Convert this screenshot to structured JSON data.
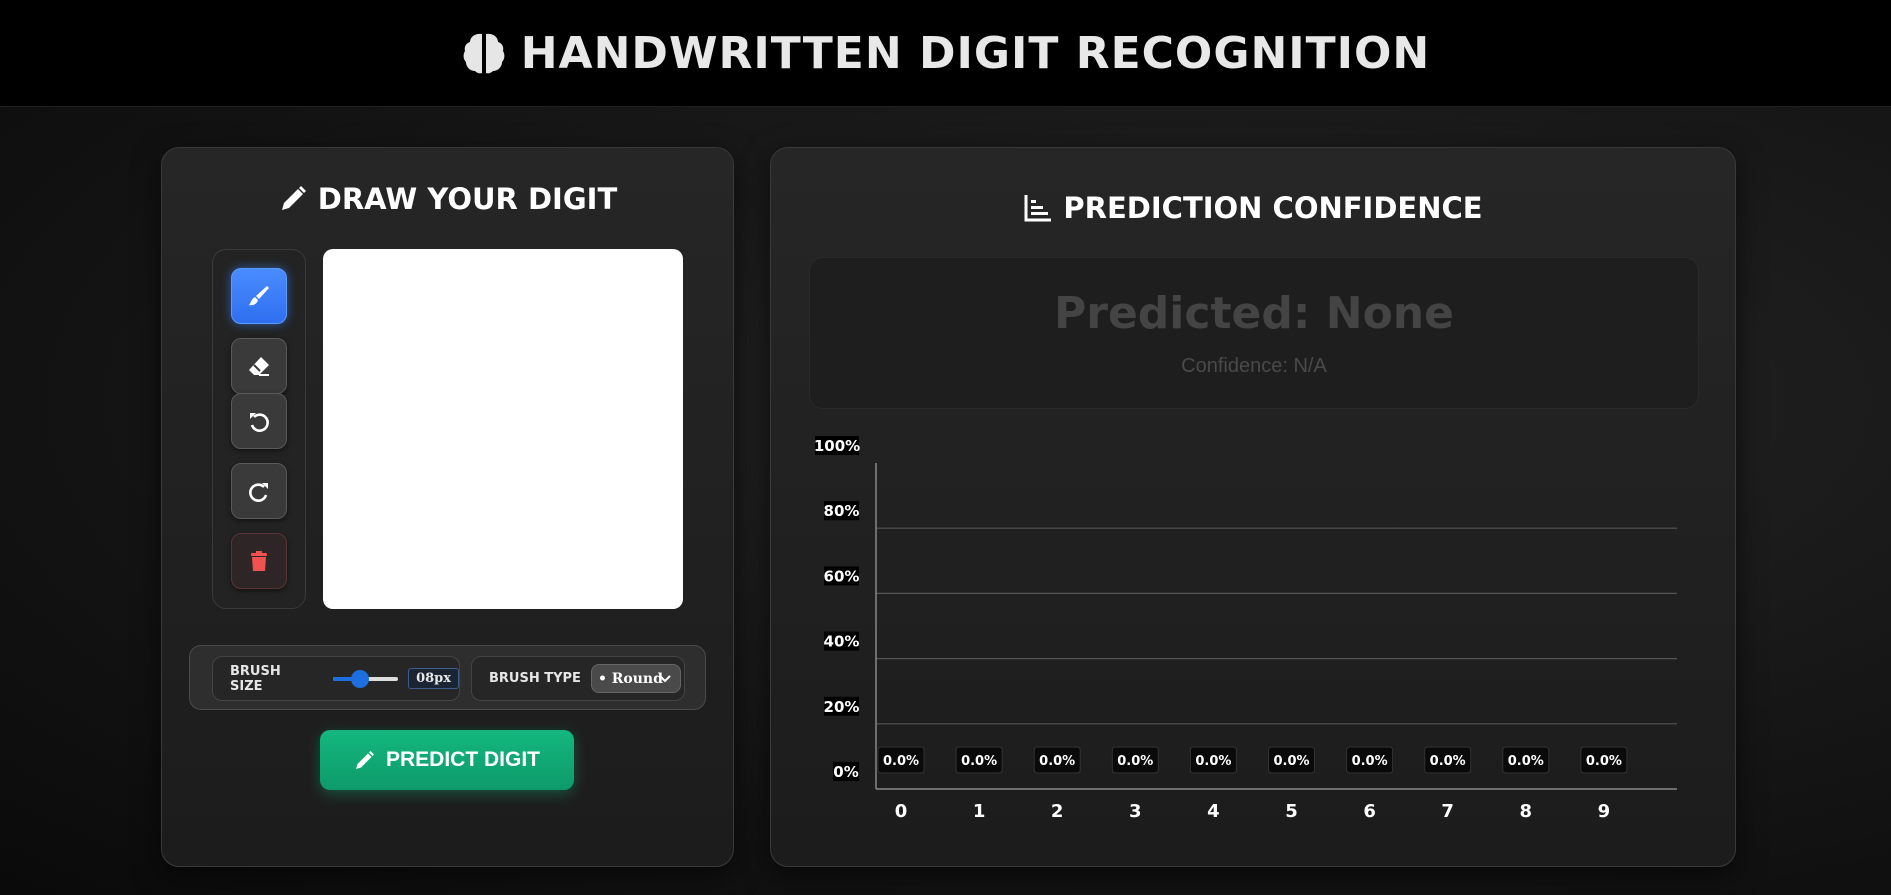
{
  "header": {
    "title": "HANDWRITTEN DIGIT RECOGNITION",
    "icon": "brain-icon"
  },
  "draw_panel": {
    "title": "DRAW YOUR DIGIT",
    "title_icon": "pencil-icon",
    "tools": [
      {
        "name": "brush",
        "icon": "brush-icon",
        "active": true
      },
      {
        "name": "eraser",
        "icon": "eraser-icon",
        "active": false
      },
      {
        "name": "undo",
        "icon": "undo-icon",
        "active": false
      },
      {
        "name": "redo",
        "icon": "redo-icon",
        "active": false
      },
      {
        "name": "clear",
        "icon": "trash-icon",
        "active": false
      }
    ],
    "brush_size_label": "BRUSH SIZE",
    "brush_size_value": "08px",
    "brush_size_fraction": 0.4,
    "brush_type_label": "BRUSH TYPE",
    "brush_type_value": "• Round",
    "predict_button": "PREDICT DIGIT"
  },
  "prediction_panel": {
    "title": "PREDICTION CONFIDENCE",
    "title_icon": "bar-chart-icon",
    "predicted_text": "Predicted: None",
    "confidence_text": "Confidence: N/A"
  },
  "chart_data": {
    "type": "bar",
    "categories": [
      "0",
      "1",
      "2",
      "3",
      "4",
      "5",
      "6",
      "7",
      "8",
      "9"
    ],
    "values": [
      0,
      0,
      0,
      0,
      0,
      0,
      0,
      0,
      0,
      0
    ],
    "value_labels": [
      "0.0%",
      "0.0%",
      "0.0%",
      "0.0%",
      "0.0%",
      "0.0%",
      "0.0%",
      "0.0%",
      "0.0%",
      "0.0%"
    ],
    "y_ticks": [
      "0%",
      "20%",
      "40%",
      "60%",
      "80%",
      "100%"
    ],
    "ylim": [
      0,
      100
    ],
    "grid": true,
    "colors": {
      "grid": "#555555",
      "axis": "#888888",
      "label_bg": "#000000"
    }
  }
}
